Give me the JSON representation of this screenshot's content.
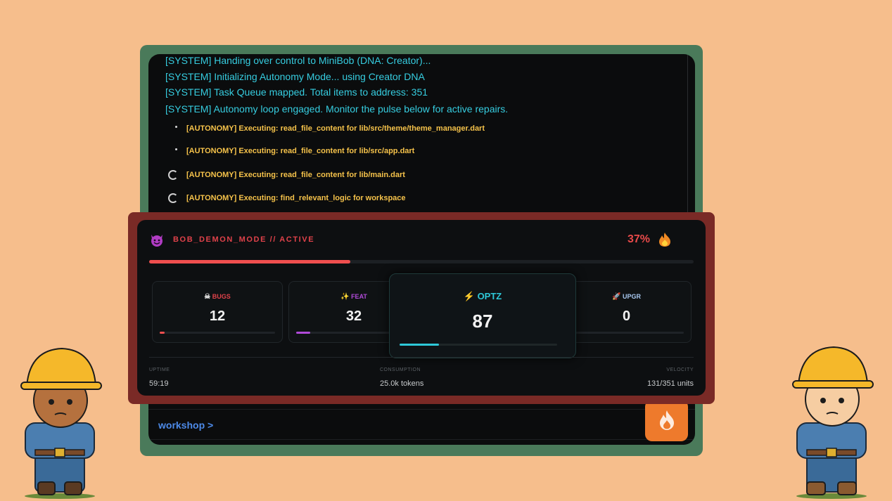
{
  "terminal": {
    "system_lines": [
      "[SYSTEM] Handing over control to MiniBob (DNA: Creator)...",
      "[SYSTEM] Initializing Autonomy Mode... using Creator DNA",
      "[SYSTEM] Task Queue mapped. Total items to address: 351",
      "[SYSTEM] Autonomy loop engaged. Monitor the pulse below for active repairs."
    ],
    "autonomy_lines": [
      "[AUTONOMY] Executing: read_file_content for lib/src/theme/theme_manager.dart",
      "[AUTONOMY] Executing: read_file_content for lib/src/app.dart",
      "[AUTONOMY] Executing: read_file_content for lib/main.dart",
      "[AUTONOMY] Executing: find_relevant_logic for workspace"
    ],
    "prompt": "workshop >"
  },
  "demon_panel": {
    "icon": "smiling-devil-icon",
    "title": "BOB_DEMON_MODE // ACTIVE",
    "percent_label": "37%",
    "progress": 0.37,
    "accent_color": "#ef4f4f",
    "stats": {
      "bugs": {
        "icon": "skull-icon",
        "label": "BUGS",
        "value": "12",
        "progress": 0.04,
        "color": "#ef4f4f"
      },
      "feat": {
        "icon": "sparkles-icon",
        "label": "FEAT",
        "value": "32",
        "progress": 0.12,
        "color": "#b04ad8"
      },
      "optz": {
        "icon": "lightning-icon",
        "label": "OPTZ",
        "value": "87",
        "progress": 0.25,
        "color": "#2ec8d8"
      },
      "upgr": {
        "icon": "rocket-icon",
        "label": "UPGR",
        "value": "0",
        "progress": 0,
        "color": "#a8c8f0"
      }
    },
    "footer": {
      "uptime_label": "UPTIME",
      "uptime_value": "59:19",
      "consumption_label": "CONSUMPTION",
      "consumption_value": "25.0k tokens",
      "velocity_label": "VELOCITY",
      "velocity_value": "131/351 units"
    }
  },
  "fire_button": {
    "icon": "flame-icon"
  },
  "characters": [
    "construction-worker-left",
    "construction-worker-right"
  ]
}
